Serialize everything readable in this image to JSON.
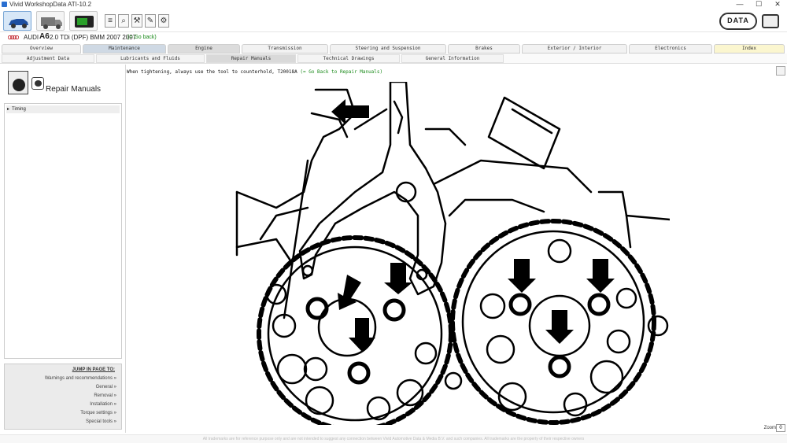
{
  "window": {
    "title": "Vivid WorkshopData ATI-10.2",
    "minimize": "—",
    "maximize": "☐",
    "close": "✕"
  },
  "toolbar": {
    "logo_text": "DATA"
  },
  "vehicle": {
    "make": "AUDI",
    "model": "A6",
    "engine": "2.0 TDi (DPF) BMM 2007 2007",
    "goback": "(= Go back)"
  },
  "tabs_main": [
    {
      "label": "Overview"
    },
    {
      "label": "Maintenance"
    },
    {
      "label": "Engine"
    },
    {
      "label": "Transmission"
    },
    {
      "label": "Steering and Suspension"
    },
    {
      "label": "Brakes"
    },
    {
      "label": "Exterior / Interior"
    },
    {
      "label": "Electronics"
    },
    {
      "label": "Index"
    }
  ],
  "tabs_sub": [
    {
      "label": "Adjustment Data"
    },
    {
      "label": "Lubricants and Fluids"
    },
    {
      "label": "Repair Manuals"
    },
    {
      "label": "Technical Drawings"
    },
    {
      "label": "General Information"
    }
  ],
  "sidebar": {
    "title": "Repair Manuals",
    "items": [
      {
        "label": "Timing"
      }
    ],
    "jump": {
      "heading": "JUMP IN PAGE TO:",
      "links": [
        {
          "label": "Warnings and recommendations »"
        },
        {
          "label": "General »"
        },
        {
          "label": "Removal »"
        },
        {
          "label": "Installation »"
        },
        {
          "label": "Torque settings »"
        },
        {
          "label": "Special tools »"
        }
      ]
    }
  },
  "content": {
    "instruction": "When tightening, always use the tool to counterhold, T20018A",
    "back_link": "(= Go Back to Repair Manuals)",
    "zoom_label": "Zoom",
    "zoom_value": "0"
  },
  "footer": {
    "text": "All trademarks are for reference purpose only and are not intended to suggest any connection between Vivid Automotive Data & Media B.V. and such companies. All trademarks are the property of their respective owners"
  }
}
